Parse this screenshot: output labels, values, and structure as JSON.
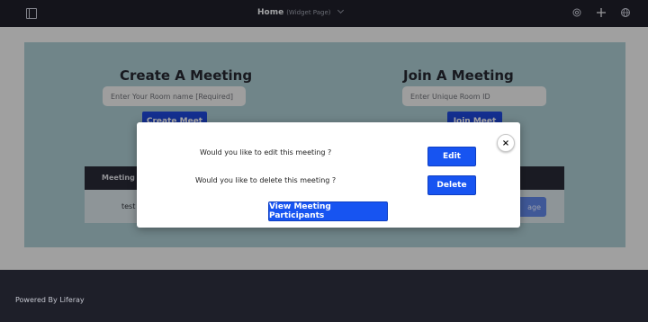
{
  "topbar": {
    "title": "Home",
    "subtitle": "(Widget Page)",
    "icons": [
      "sidebar-toggle-icon",
      "gear-icon",
      "plus-icon",
      "globe-icon"
    ]
  },
  "create": {
    "title": "Create A Meeting",
    "room_placeholder": "Enter Your Room name [Required]",
    "button": "Create Meet"
  },
  "join": {
    "title": "Join A Meeting",
    "room_placeholder": "Enter Unique Room ID",
    "button": "Join Meet"
  },
  "table": {
    "header_partial": "Meeting N",
    "row_name": "test",
    "manage_partial": "age"
  },
  "modal": {
    "edit_question": "Would you like to edit this meeting ?",
    "edit_button": "Edit",
    "delete_question": "Would you like to delete this meeting ?",
    "delete_button": "Delete",
    "participants_button": "View Meeting Participants",
    "close_symbol": "×"
  },
  "footer": {
    "text": "Powered By Liferay"
  },
  "colors": {
    "topbar": "#1e1f29",
    "panel": "#a7c7cc",
    "primary": "#1754f1"
  }
}
